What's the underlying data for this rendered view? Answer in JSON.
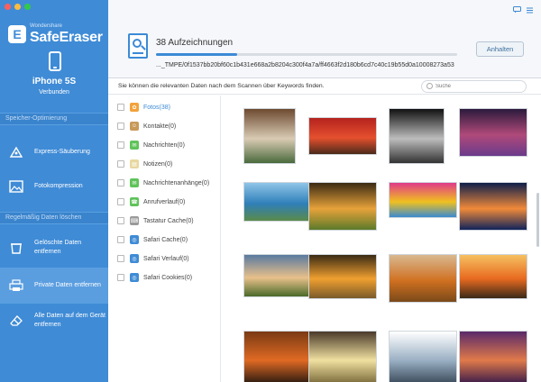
{
  "app": {
    "brand_small": "Wondershare",
    "brand_name": "SafeEraser",
    "colors": {
      "accent": "#3c8ad6",
      "sidebar": "#3f8bd6",
      "active": "#5b9ee0"
    }
  },
  "device": {
    "name": "iPhone 5S",
    "status": "Verbunden"
  },
  "sidebar": {
    "section1_title": "Speicher-Optimierung",
    "section2_title": "Regelmäßig Daten löschen",
    "items": [
      {
        "label": "Express-Säuberung",
        "icon": "rocket-icon"
      },
      {
        "label": "Fotokompression",
        "icon": "photo-icon"
      },
      {
        "label": "Gelöschte Daten entfernen",
        "icon": "trash-icon"
      },
      {
        "label": "Private Daten entfernen",
        "icon": "printer-icon",
        "active": true
      },
      {
        "label": "Alle Daten auf dem Gerät entfernen",
        "icon": "eraser-icon"
      }
    ]
  },
  "scan": {
    "record_count": "38 Aufzeichnungen",
    "progress": 0.27,
    "filepath": "..._TMPE/0f1537bb20bf60c1b431e668a2b8204c300f4a7a/ff4663f2d180b6cd7c40c19b55d0a10008273a53",
    "stop_label": "Anhalten"
  },
  "hint": "Sie können die relevanten Daten nach dem Scannen über Keywords finden.",
  "search": {
    "placeholder": "Suche"
  },
  "categories": [
    {
      "label": "Fotos(38)",
      "icon": "photos-icon",
      "color": "#f2a23a"
    },
    {
      "label": "Kontakte(0)",
      "icon": "contacts-icon",
      "color": "#c89a5a"
    },
    {
      "label": "Nachrichten(0)",
      "icon": "messages-icon",
      "color": "#5fc35a"
    },
    {
      "label": "Notizen(0)",
      "icon": "notes-icon",
      "color": "#e8d8a0"
    },
    {
      "label": "Nachrichtenanhänge(0)",
      "icon": "attachments-icon",
      "color": "#5fc35a"
    },
    {
      "label": "Anrufverlauf(0)",
      "icon": "phone-icon",
      "color": "#5fc35a"
    },
    {
      "label": "Tastatur Cache(0)",
      "icon": "keyboard-icon",
      "color": "#9a9a9a"
    },
    {
      "label": "Safari Cache(0)",
      "icon": "safari-icon",
      "color": "#3f8bd6"
    },
    {
      "label": "Safari Verlauf(0)",
      "icon": "safari-icon",
      "color": "#3f8bd6"
    },
    {
      "label": "Safari Cookies(0)",
      "icon": "safari-icon",
      "color": "#3f8bd6"
    }
  ],
  "photos": [
    {
      "name": "daisy-photo",
      "colors": [
        "#6d4a30",
        "#d9cbb4",
        "#4a6a3c"
      ]
    },
    {
      "name": "red-autumn-forest-photo",
      "colors": [
        "#b4231e",
        "#e5502e",
        "#4a2a1a"
      ]
    },
    {
      "name": "woman-portrait-photo",
      "colors": [
        "#111111",
        "#bdbdbd",
        "#333333"
      ]
    },
    {
      "name": "purple-stairs-photo",
      "colors": [
        "#2b1a3c",
        "#b04a7a",
        "#6a3a8a"
      ]
    },
    {
      "name": "mountain-lake-photo",
      "colors": [
        "#8fc4e8",
        "#2f7fb8",
        "#5a8a4a"
      ]
    },
    {
      "name": "tree-sunset-photo",
      "colors": [
        "#3b2a14",
        "#e7a23a",
        "#5b7a2a"
      ]
    },
    {
      "name": "colorful-abstract-photo",
      "colors": [
        "#e03a8a",
        "#f0c020",
        "#3a8ad0"
      ]
    },
    {
      "name": "blue-dusk-silhouette-photo",
      "colors": [
        "#0e1e4a",
        "#f08a3a",
        "#10235a"
      ]
    },
    {
      "name": "lone-tree-field-photo",
      "colors": [
        "#5a7aa0",
        "#e8c08a",
        "#4a6a2a"
      ]
    },
    {
      "name": "sunset-shore-photo",
      "colors": [
        "#3a2a14",
        "#f0a030",
        "#7a5a2a"
      ]
    },
    {
      "name": "autumn-tree-photo",
      "colors": [
        "#d8b890",
        "#d07020",
        "#7a4a1a"
      ]
    },
    {
      "name": "pier-sunset-photo",
      "colors": [
        "#f5c060",
        "#e86a20",
        "#3a2a18"
      ]
    },
    {
      "name": "orange-sky-photo",
      "colors": [
        "#7a3a14",
        "#e06a24",
        "#2a1a10"
      ]
    },
    {
      "name": "bright-sun-photo",
      "colors": [
        "#4a3a2a",
        "#f0e0a0",
        "#7a6a3a"
      ]
    },
    {
      "name": "sehnsucht-text-photo",
      "colors": [
        "#ffffff",
        "#9ab0c4",
        "#3a4a5a"
      ]
    },
    {
      "name": "purple-sunset-photo",
      "colors": [
        "#5a2a6a",
        "#e07a4a",
        "#3a1a4a"
      ]
    }
  ]
}
